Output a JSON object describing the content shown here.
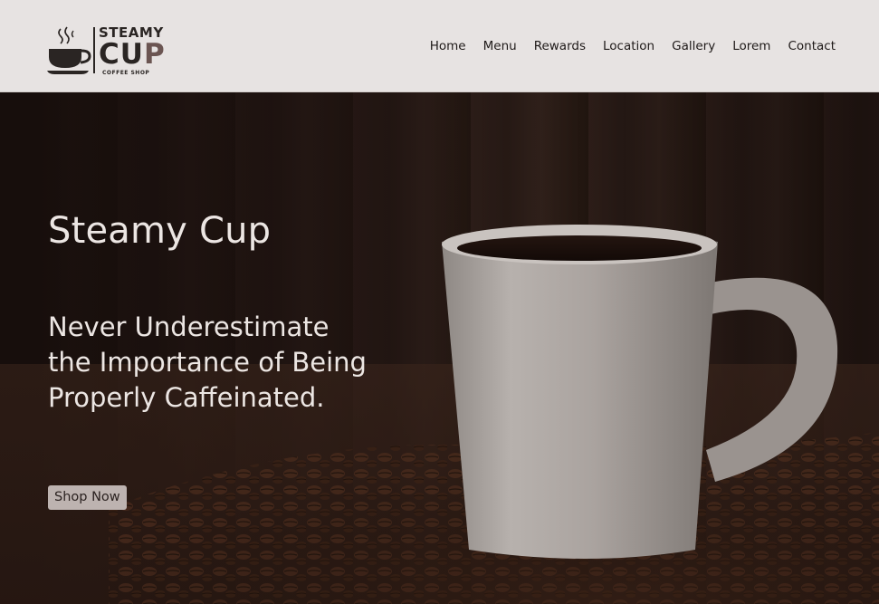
{
  "brand": {
    "line1": "STEAMY",
    "line2_main": "CU",
    "line2_accent": "P",
    "tagline": "COFFEE SHOP"
  },
  "nav": {
    "items": [
      {
        "label": "Home"
      },
      {
        "label": "Menu"
      },
      {
        "label": "Rewards"
      },
      {
        "label": "Location"
      },
      {
        "label": "Gallery"
      },
      {
        "label": "Lorem"
      },
      {
        "label": "Contact"
      }
    ]
  },
  "hero": {
    "title": "Steamy Cup",
    "tagline": "Never Underestimate\nthe Importance of Being\nProperly Caffeinated.",
    "cta_label": "Shop Now"
  },
  "colors": {
    "header_bg": "#e7e3e2",
    "text_dark": "#2a2523",
    "accent": "#6b5552",
    "hero_text": "#ece6e3",
    "button_bg": "#bdb3b0"
  }
}
